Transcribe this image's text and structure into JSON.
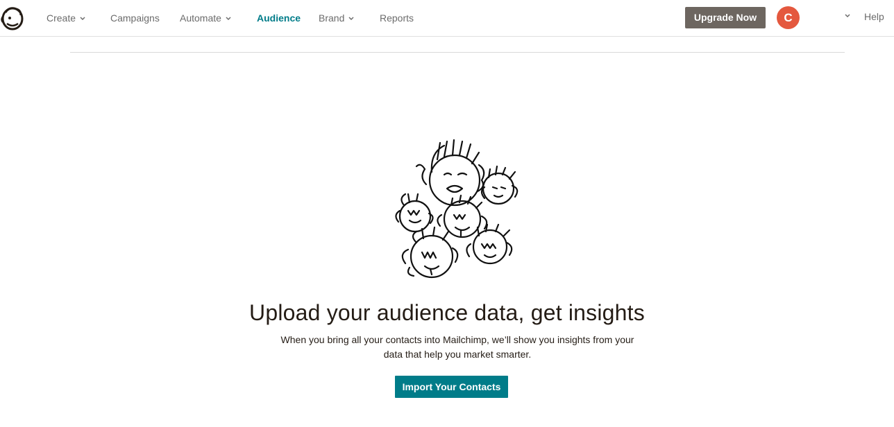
{
  "nav": {
    "items": [
      {
        "label": "Create",
        "has_dropdown": true
      },
      {
        "label": "Campaigns",
        "has_dropdown": false
      },
      {
        "label": "Automate",
        "has_dropdown": true
      },
      {
        "label": "Audience",
        "has_dropdown": false,
        "active": true
      },
      {
        "label": "Brand",
        "has_dropdown": true
      },
      {
        "label": "Reports",
        "has_dropdown": false
      }
    ],
    "upgrade_label": "Upgrade Now",
    "avatar_initial": "C",
    "help_label": "Help"
  },
  "main": {
    "illustration_icon": "doodle-faces-illustration",
    "headline": "Upload your audience data, get insights",
    "subtext_line1": "When you bring all your contacts into Mailchimp, we’ll show you insights from your",
    "subtext_line2": "data that help you market smarter.",
    "import_label": "Import Your Contacts"
  },
  "colors": {
    "accent": "#007c89",
    "upgrade_button": "#6d6660",
    "avatar": "#e4583e",
    "text": "#241c15"
  }
}
